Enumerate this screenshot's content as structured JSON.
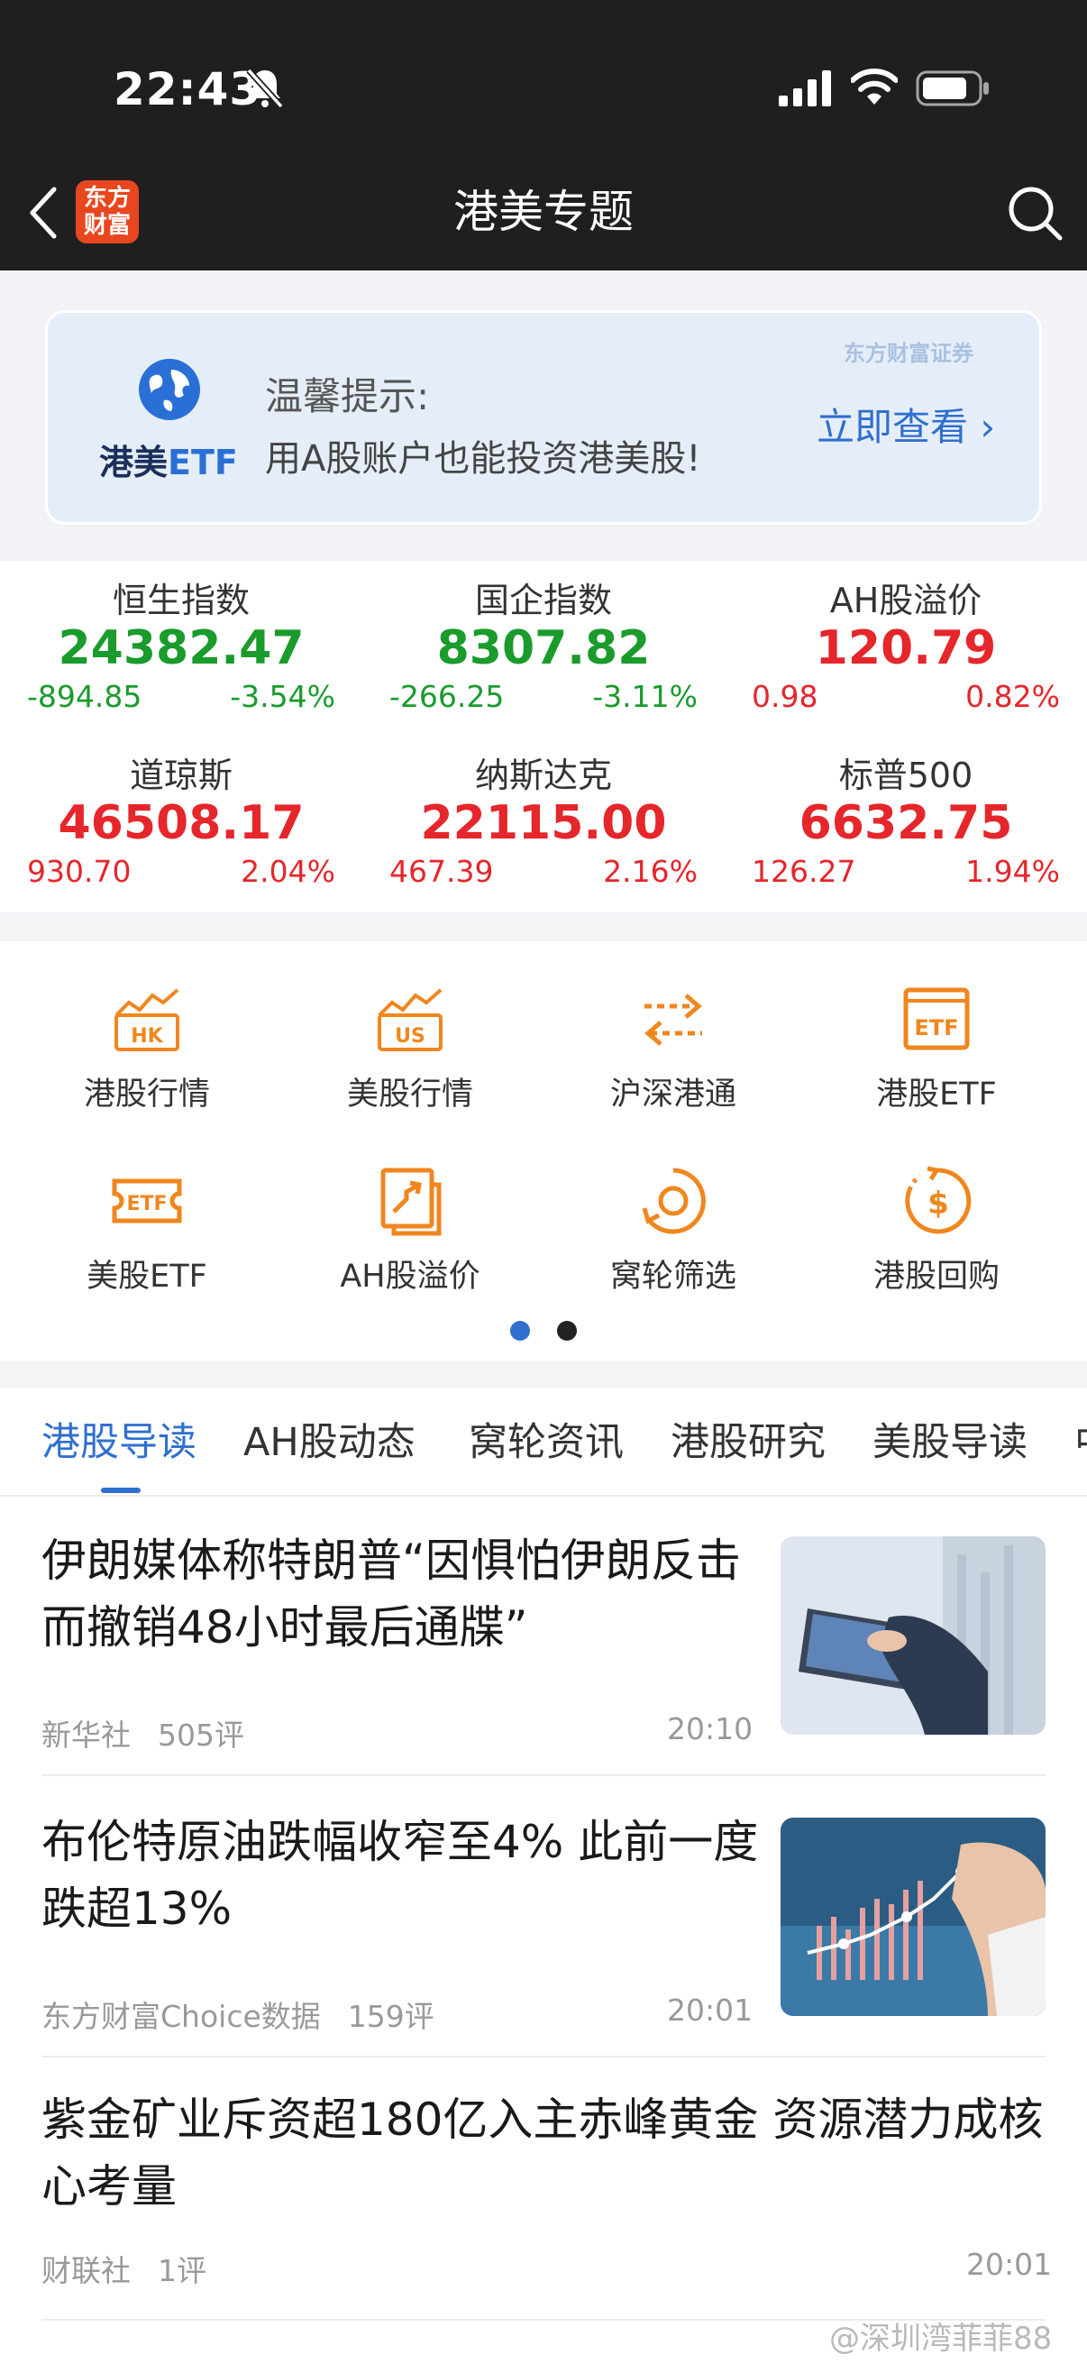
{
  "status_bar": {
    "time": "22:43",
    "icons": [
      "bell-slash-icon",
      "signal-icon",
      "wifi-icon",
      "battery-icon"
    ]
  },
  "nav": {
    "logo_text_1": "东方",
    "logo_text_2": "财富",
    "title": "港美专题",
    "icons": [
      "chevron-left-icon",
      "search-icon"
    ]
  },
  "banner": {
    "brand_main": "港美",
    "brand_etf": "ETF",
    "tip_title": "温馨提示:",
    "tip_text": "用A股账户也能投资港美股!",
    "watermark": "东方财富证券",
    "view_label": "立即查看 ›",
    "accent": "#2f6fd0"
  },
  "indices": [
    {
      "name": "恒生指数",
      "value": "24382.47",
      "change": "-894.85",
      "pct": "-3.54%",
      "trend": "down"
    },
    {
      "name": "国企指数",
      "value": "8307.82",
      "change": "-266.25",
      "pct": "-3.11%",
      "trend": "down"
    },
    {
      "name": "AH股溢价",
      "value": "120.79",
      "change": "0.98",
      "pct": "0.82%",
      "trend": "up"
    },
    {
      "name": "道琼斯",
      "value": "46508.17",
      "change": "930.70",
      "pct": "2.04%",
      "trend": "up"
    },
    {
      "name": "纳斯达克",
      "value": "22115.00",
      "change": "467.39",
      "pct": "2.16%",
      "trend": "up"
    },
    {
      "name": "标普500",
      "value": "6632.75",
      "change": "126.27",
      "pct": "1.94%",
      "trend": "up"
    }
  ],
  "colors": {
    "up": "#e5262b",
    "down": "#1a9b2c",
    "icon_orange": "#f0861e"
  },
  "grid": [
    {
      "label": "港股行情",
      "icon": "hk-chart-icon"
    },
    {
      "label": "美股行情",
      "icon": "us-chart-icon"
    },
    {
      "label": "沪深港通",
      "icon": "exchange-arrows-icon"
    },
    {
      "label": "港股ETF",
      "icon": "etf-box-icon"
    },
    {
      "label": "美股ETF",
      "icon": "etf-ticket-icon"
    },
    {
      "label": "AH股溢价",
      "icon": "premium-arrow-icon"
    },
    {
      "label": "窝轮筛选",
      "icon": "warrant-filter-icon"
    },
    {
      "label": "港股回购",
      "icon": "buyback-dollar-icon"
    }
  ],
  "pager": {
    "pages": 2,
    "active": 1
  },
  "tabs": [
    "港股导读",
    "AH股动态",
    "窝轮资讯",
    "港股研究",
    "美股导读",
    "中"
  ],
  "news": [
    {
      "title": "伊朗媒体称特朗普“因惧怕伊朗反击而撤销48小时最后通牒”",
      "source": "新华社",
      "comments": "505评",
      "time": "20:10",
      "thumb": "tablet-hand-image"
    },
    {
      "title": "布伦特原油跌幅收窄至4% 此前一度跌超13%",
      "source": "东方财富Choice数据",
      "comments": "159评",
      "time": "20:01",
      "thumb": "chart-hand-image"
    },
    {
      "title": "紫金矿业斥资超180亿入主赤峰黄金 资源潜力成核心考量",
      "source": "财联社",
      "comments": "1评",
      "time": "20:01"
    }
  ],
  "watermark": "@深圳湾菲菲88"
}
